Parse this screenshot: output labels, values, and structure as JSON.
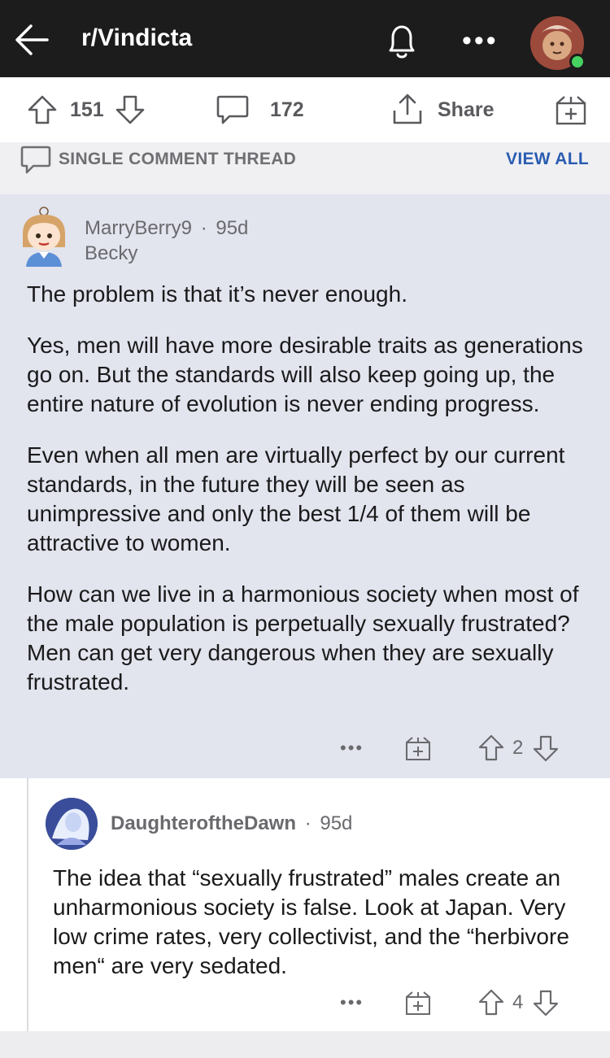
{
  "header": {
    "subreddit": "r/Vindicta",
    "back_icon": "back-arrow-icon",
    "bell_icon": "bell-icon",
    "more_icon": "more-icon",
    "more_label": "•••",
    "online_color": "#46d160"
  },
  "actions": {
    "upvotes": "151",
    "comments": "172",
    "share_label": "Share"
  },
  "thread": {
    "label": "SINGLE COMMENT THREAD",
    "view_all": "VIEW ALL"
  },
  "comment1": {
    "username": "MarryBerry9",
    "separator": "·",
    "age": "95d",
    "flair": "Becky",
    "paragraphs": [
      "The problem is that it’s never enough.",
      "Yes, men will have more desirable traits as generations go on. But the standards will also keep going up, the entire nature of evolution is never ending progress.",
      "Even when all men are virtually perfect by our current standards, in the future they will be seen as unimpressive and only the best 1/4 of them will be attractive to women.",
      "How can we live in a harmonious society when most of the male population is perpetually sexually frustrated? Men can get very dangerous when they are sexually frustrated."
    ],
    "more_label": "•••",
    "score": "2"
  },
  "comment2": {
    "username": "DaughteroftheDawn",
    "separator": "·",
    "age": "95d",
    "body": "The idea that “sexually frustrated” males create an unharmonious society is false. Look at Japan. Very low crime rates, very collectivist, and the “herbivore men“ are very sedated.",
    "more_label": "•••",
    "score": "4"
  },
  "colors": {
    "header_bg": "#1c1c1c",
    "highlight_bg": "#e2e4ee",
    "link_blue": "#2a5cb0"
  }
}
